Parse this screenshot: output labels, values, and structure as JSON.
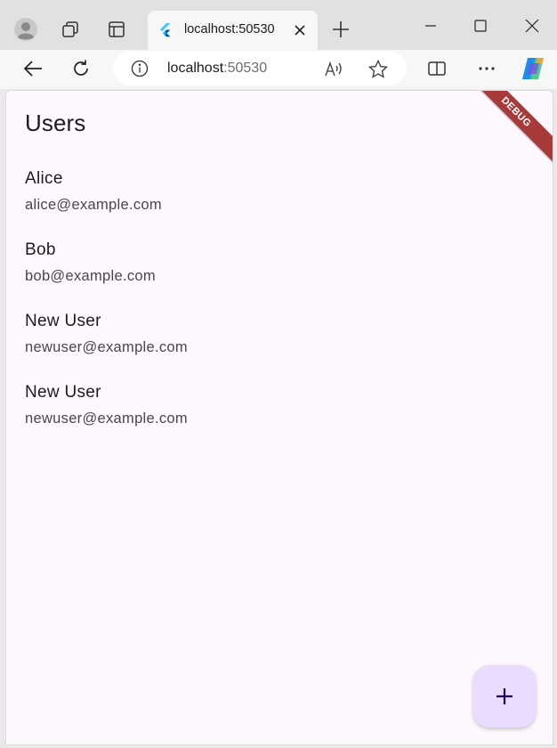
{
  "browser": {
    "tab": {
      "title": "localhost:50530",
      "favicon": "flutter-icon"
    },
    "address": {
      "host": "localhost",
      "port": ":50530"
    },
    "icons": {
      "profile": "profile-icon",
      "collections": "collections-icon",
      "tab_actions": "tab-actions-icon",
      "close_tab": "close-icon",
      "new_tab": "plus-icon",
      "back": "back-arrow-icon",
      "refresh": "refresh-icon",
      "info": "info-icon",
      "read_aloud": "read-aloud-icon",
      "favorite": "star-icon",
      "split_screen": "split-screen-icon",
      "more": "more-icon",
      "copilot": "copilot-icon"
    }
  },
  "app": {
    "title": "Users",
    "debug_banner": "DEBUG",
    "users": [
      {
        "name": "Alice",
        "email": "alice@example.com"
      },
      {
        "name": "Bob",
        "email": "bob@example.com"
      },
      {
        "name": "New User",
        "email": "newuser@example.com"
      },
      {
        "name": "New User",
        "email": "newuser@example.com"
      }
    ],
    "fab": {
      "icon": "add-icon"
    },
    "colors": {
      "background": "#fdf7fe",
      "fab": "#eadcfd",
      "debug_banner": "#a83a3a",
      "fab_icon": "#21005d"
    }
  }
}
